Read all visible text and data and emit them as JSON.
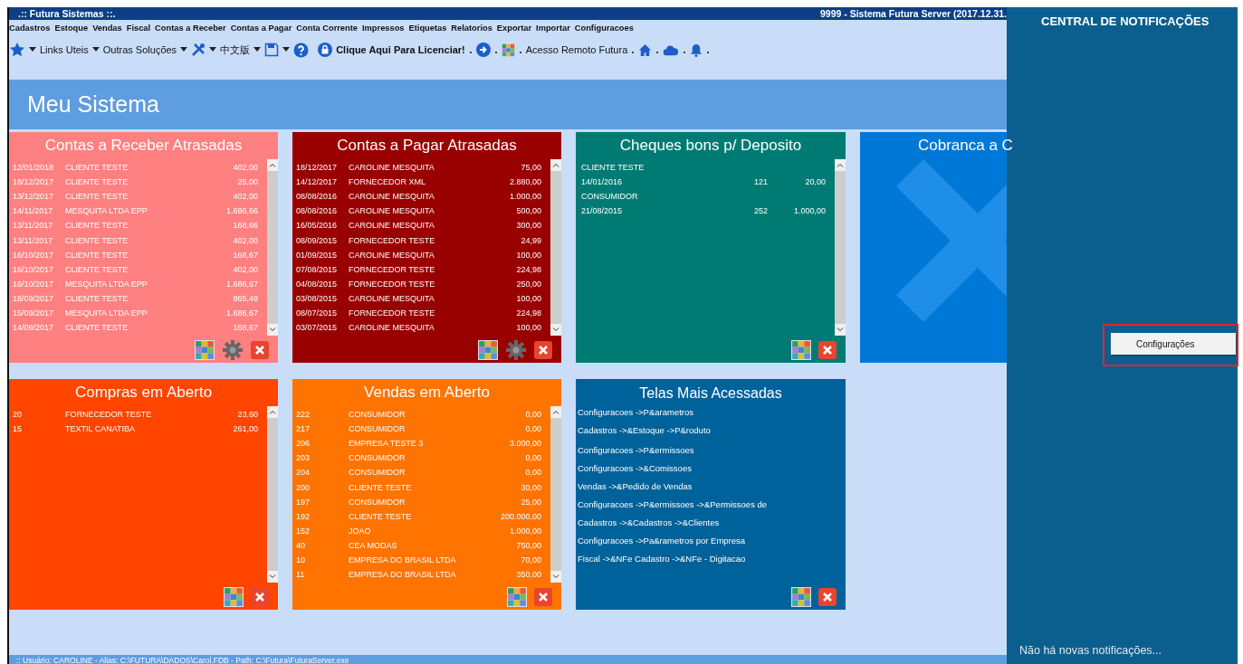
{
  "window": {
    "title": ".:: Futura Sistemas ::.",
    "server_title": "9999 - Sistema Futura Server (2017.12.31."
  },
  "menu": [
    "Cadastros",
    "Estoque",
    "Vendas",
    "Fiscal",
    "Contas a Receber",
    "Contas a Pagar",
    "Conta Corrente",
    "Impressos",
    "Etiquetas",
    "Relatorios",
    "Exportar",
    "Importar",
    "Configuracoes"
  ],
  "toolbar": [
    {
      "kind": "star"
    },
    {
      "kind": "caret"
    },
    {
      "kind": "label",
      "label": "Links Uteis"
    },
    {
      "kind": "caret"
    },
    {
      "kind": "label",
      "label": "Outras Soluções"
    },
    {
      "kind": "caret"
    },
    {
      "kind": "tools"
    },
    {
      "kind": "caret"
    },
    {
      "kind": "label",
      "label": "中文版"
    },
    {
      "kind": "caret"
    },
    {
      "kind": "save"
    },
    {
      "kind": "caret"
    },
    {
      "kind": "help"
    },
    {
      "kind": "license",
      "label": "Clique Aqui Para Licenciar!"
    },
    {
      "kind": "sep"
    },
    {
      "kind": "exit"
    },
    {
      "kind": "sep"
    },
    {
      "kind": "palette"
    },
    {
      "kind": "sep"
    },
    {
      "kind": "label",
      "label": "Acesso Remoto Futura"
    },
    {
      "kind": "sep"
    },
    {
      "kind": "home"
    },
    {
      "kind": "sep"
    },
    {
      "kind": "cloud"
    },
    {
      "kind": "sep"
    },
    {
      "kind": "bell"
    },
    {
      "kind": "sep"
    }
  ],
  "header": {
    "title": "Meu Sistema"
  },
  "cards": [
    {
      "title": "Contas a Receber Atrasadas",
      "kind": "table",
      "color": "#ff8080",
      "gear": true,
      "scrollbar": true,
      "rows": [
        [
          "12/01/2018",
          "CLIENTE TESTE",
          "402,00"
        ],
        [
          "18/12/2017",
          "CLIENTE TESTE",
          "25,00"
        ],
        [
          "13/12/2017",
          "CLIENTE TESTE",
          "402,00"
        ],
        [
          "14/11/2017",
          "MESQUITA LTDA EPP",
          "1.686,66"
        ],
        [
          "13/11/2017",
          "CLIENTE TESTE",
          "168,66"
        ],
        [
          "13/11/2017",
          "CLIENTE TESTE",
          "402,00"
        ],
        [
          "16/10/2017",
          "CLIENTE TESTE",
          "168,67"
        ],
        [
          "16/10/2017",
          "CLIENTE TESTE",
          "402,00"
        ],
        [
          "16/10/2017",
          "MESQUITA LTDA EPP",
          "1.686,67"
        ],
        [
          "18/09/2017",
          "CLIENTE TESTE",
          "865,49"
        ],
        [
          "15/09/2017",
          "MESQUITA LTDA EPP",
          "1.686,67"
        ],
        [
          "14/09/2017",
          "CLIENTE TESTE",
          "168,67"
        ]
      ]
    },
    {
      "title": "Contas a Pagar Atrasadas",
      "kind": "table",
      "color": "#990000",
      "gear": true,
      "scrollbar": true,
      "rows": [
        [
          "18/12/2017",
          "CAROLINE MESQUITA",
          "75,00"
        ],
        [
          "14/12/2017",
          "FORNECEDOR XML",
          "2.880,00"
        ],
        [
          "08/08/2016",
          "CAROLINE MESQUITA",
          "1.000,00"
        ],
        [
          "08/08/2016",
          "CAROLINE MESQUITA",
          "500,00"
        ],
        [
          "16/05/2016",
          "CAROLINE MESQUITA",
          "300,00"
        ],
        [
          "08/09/2015",
          "FORNECEDOR TESTE",
          "24,99"
        ],
        [
          "01/09/2015",
          "CAROLINE MESQUITA",
          "100,00"
        ],
        [
          "07/08/2015",
          "FORNECEDOR TESTE",
          "224,98"
        ],
        [
          "04/08/2015",
          "FORNECEDOR TESTE",
          "250,00"
        ],
        [
          "03/08/2015",
          "CAROLINE MESQUITA",
          "100,00"
        ],
        [
          "08/07/2015",
          "FORNECEDOR TESTE",
          "224,98"
        ],
        [
          "03/07/2015",
          "CAROLINE MESQUITA",
          "100,00"
        ]
      ]
    },
    {
      "title": "Cheques bons p/ Deposito",
      "kind": "cheques",
      "color": "#007b73",
      "gear": false,
      "scrollbar": true,
      "items": [
        {
          "name": "CLIENTE TESTE",
          "date": "14/01/2016",
          "number": "121",
          "value": "20,00"
        },
        {
          "name": "CONSUMIDOR",
          "date": "21/08/2015",
          "number": "252",
          "value": "1.000,00"
        }
      ]
    },
    {
      "title": "Cobranca a C",
      "kind": "empty",
      "color": "#0078d7",
      "gear": false,
      "scrollbar": false
    },
    {
      "title": "Compras em Aberto",
      "kind": "table",
      "color": "#ff4500",
      "gear": false,
      "scrollbar": true,
      "rows": [
        [
          "20",
          "FORNECEDOR TESTE",
          "23,60"
        ],
        [
          "15",
          "TEXTIL CANATIBA",
          "261,00"
        ]
      ]
    },
    {
      "title": "Vendas em Aberto",
      "kind": "table",
      "color": "#ff7300",
      "gear": false,
      "scrollbar": true,
      "rows": [
        [
          "222",
          "CONSUMIDOR",
          "0,00"
        ],
        [
          "217",
          "CONSUMIDOR",
          "0,00"
        ],
        [
          "206",
          "EMPRESA TESTE 3",
          "3.000,00"
        ],
        [
          "203",
          "CONSUMIDOR",
          "0,00"
        ],
        [
          "204",
          "CONSUMIDOR",
          "0,00"
        ],
        [
          "200",
          "CLIENTE TESTE",
          "30,00"
        ],
        [
          "197",
          "CONSUMIDOR",
          "25,00"
        ],
        [
          "192",
          "CLIENTE TESTE",
          "200.000,00"
        ],
        [
          "152",
          "JOAO",
          "1.000,00"
        ],
        [
          "40",
          "CEA MODAS",
          "750,00"
        ],
        [
          "10",
          "EMPRESA DO BRASIL LTDA",
          "70,00"
        ],
        [
          "11",
          "EMPRESA DO BRASIL LTDA",
          "350,00"
        ]
      ]
    },
    {
      "title": "Telas Mais Acessadas",
      "kind": "links",
      "color": "#00629b",
      "gear": false,
      "scrollbar": false,
      "links": [
        "Configuracoes ->P&arametros",
        "Cadastros ->&Estoque ->P&roduto",
        "Configuracoes ->P&ermissoes",
        "Configuracoes ->&Comissoes",
        "Vendas ->&Pedido de Vendas",
        "Configuracoes ->P&ermissoes ->&Permissoes de",
        "Cadastros ->&Cadastros ->&Clientes",
        "Configuracoes ->Pa&rametros por Empresa",
        "Fiscal ->&NFe Cadastro ->&NFe - Digitacao"
      ]
    }
  ],
  "notifications": {
    "title": "CENTRAL DE NOTIFICAÇÕES",
    "empty_message": "Não há novas notificações...",
    "context_menu": {
      "annotated": true,
      "items": [
        {
          "label": "Configurações"
        }
      ]
    }
  },
  "status_bar": ":: Usuário: CAROLINE  - Alias: C:\\FUTURA\\DADOS\\Carol.FDB - Path: C:\\Futura\\FuturaServer.exe"
}
